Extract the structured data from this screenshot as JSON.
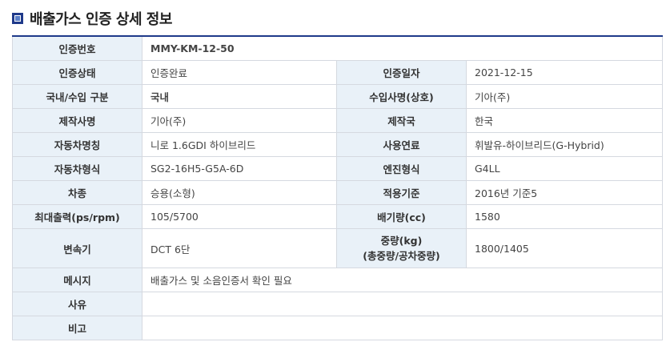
{
  "page": {
    "title": "배출가스 인증 상세 정보"
  },
  "labels": {
    "cert_no": "인증번호",
    "cert_status": "인증상태",
    "cert_date": "인증일자",
    "origin": "국내/수입 구분",
    "importer": "수입사명(상호)",
    "maker": "제작사명",
    "country": "제작국",
    "vehicle_name": "자동차명칭",
    "fuel": "사용연료",
    "vehicle_type": "자동차형식",
    "engine_type": "엔진형식",
    "category": "차종",
    "standard": "적용기준",
    "max_output": "최대출력(ps/rpm)",
    "displacement": "배기량(cc)",
    "transmission": "변속기",
    "weight_line1": "중량(kg)",
    "weight_line2": "(총중량/공차중량)",
    "message": "메시지",
    "reason": "사유",
    "remarks": "비고"
  },
  "values": {
    "cert_no": "MMY-KM-12-50",
    "cert_status": "인증완료",
    "cert_date": "2021-12-15",
    "origin": "국내",
    "importer": "기아(주)",
    "maker": "기아(주)",
    "country": "한국",
    "vehicle_name": "니로 1.6GDI 하이브리드",
    "fuel": "휘발유-하이브리드(G-Hybrid)",
    "vehicle_type": "SG2-16H5-G5A-6D",
    "engine_type": "G4LL",
    "category": "승용(소형)",
    "standard": "2016년 기준5",
    "max_output": "105/5700",
    "displacement": "1580",
    "transmission": "DCT 6단",
    "weight": "1800/1405",
    "message": "배출가스 및 소음인증서 확인 필요",
    "reason": "",
    "remarks": ""
  },
  "colors": {
    "accent": "#e05a5a",
    "header_bg": "#e9f1f8",
    "border_top": "#1f3a8a"
  },
  "icons": {
    "title": "square-bullet-icon"
  }
}
